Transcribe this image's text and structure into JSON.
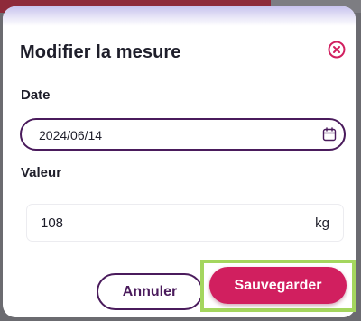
{
  "dialog": {
    "title": "Modifier la mesure",
    "close_icon": "close-circle-icon"
  },
  "date_field": {
    "label": "Date",
    "value": "2024/06/14",
    "icon": "calendar-icon"
  },
  "value_field": {
    "label": "Valeur",
    "value": "108",
    "unit": "kg"
  },
  "actions": {
    "cancel_label": "Annuler",
    "save_label": "Sauvegarder"
  },
  "colors": {
    "accent": "#d11f5f",
    "border": "#4a1b5c",
    "highlight": "#a4d65e"
  }
}
